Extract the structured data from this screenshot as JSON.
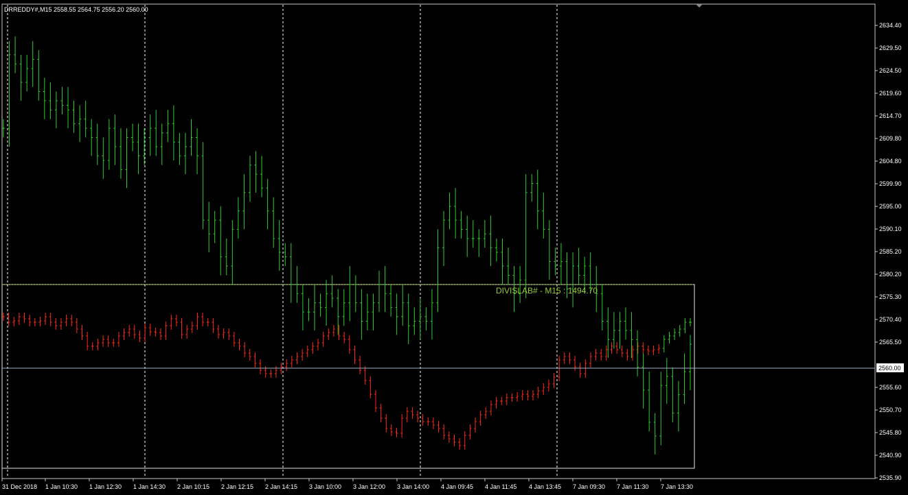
{
  "header": {
    "symbol_line": "DRREDDY#,M15  2558.55 2564.75 2556.20 2560.00"
  },
  "overlay": {
    "label": "DIVISLAB# - M15 : 1494.70"
  },
  "price_axis": {
    "labels": [
      "2634.40",
      "2629.50",
      "2624.50",
      "2619.60",
      "2614.70",
      "2609.80",
      "2604.80",
      "2599.90",
      "2595.00",
      "2590.10",
      "2585.20",
      "2580.20",
      "2575.30",
      "2570.40",
      "2565.50",
      "2560.00",
      "2555.60",
      "2550.70",
      "2545.80",
      "2540.90",
      "2535.90"
    ],
    "current_price": "2560.00"
  },
  "time_axis": {
    "labels": [
      "31 Dec 2018",
      "1 Jan 10:30",
      "1 Jan 12:30",
      "1 Jan 14:30",
      "2 Jan 10:15",
      "2 Jan 12:15",
      "2 Jan 14:15",
      "3 Jan 10:00",
      "3 Jan 12:00",
      "3 Jan 14:00",
      "4 Jan 09:45",
      "4 Jan 11:45",
      "4 Jan 13:45",
      "7 Jan 09:30",
      "7 Jan 11:30",
      "7 Jan 13:30"
    ]
  },
  "colors": {
    "background": "#000000",
    "main_bars": "#32cd32",
    "overlay_bars": "#ff2a1a",
    "overlay_bars_up": "#32cd32",
    "overlay_label": "#9acd32",
    "grid_dashed": "#ffffff",
    "current_line": "#a0b0c8"
  },
  "chart_data": {
    "type": "ohlc",
    "main_series": {
      "name": "DRREDDY#,M15",
      "close": [
        2612,
        2628,
        2626,
        2622,
        2625,
        2627,
        2620,
        2618,
        2616,
        2618,
        2617,
        2616,
        2613,
        2614,
        2612,
        2610,
        2606,
        2605,
        2612,
        2608,
        2603,
        2610,
        2609,
        2606,
        2610,
        2612,
        2608,
        2611,
        2613,
        2609,
        2606,
        2608,
        2610,
        2606,
        2592,
        2589,
        2592,
        2584,
        2582,
        2590,
        2594,
        2598,
        2604,
        2602,
        2599,
        2594,
        2588,
        2585,
        2584,
        2578,
        2576,
        2572,
        2572,
        2574,
        2573,
        2576,
        2575,
        2571,
        2574,
        2578,
        2574,
        2570,
        2572,
        2574,
        2578,
        2576,
        2573,
        2571,
        2574,
        2569,
        2570,
        2571,
        2570,
        2574,
        2586,
        2592,
        2595,
        2592,
        2590,
        2588,
        2588,
        2588,
        2589,
        2586,
        2585,
        2582,
        2580,
        2576,
        2579,
        2598,
        2600,
        2594,
        2590,
        2583,
        2582,
        2583,
        2577,
        2582,
        2580,
        2582,
        2578,
        2576,
        2570,
        2566,
        2568,
        2570,
        2568,
        2566,
        2560,
        2555,
        2548,
        2545,
        2556,
        2558,
        2550,
        2554,
        2559,
        2565
      ]
    },
    "overlay_series": {
      "name": "DIVISLAB# - M15",
      "last": 1494.7
    }
  }
}
